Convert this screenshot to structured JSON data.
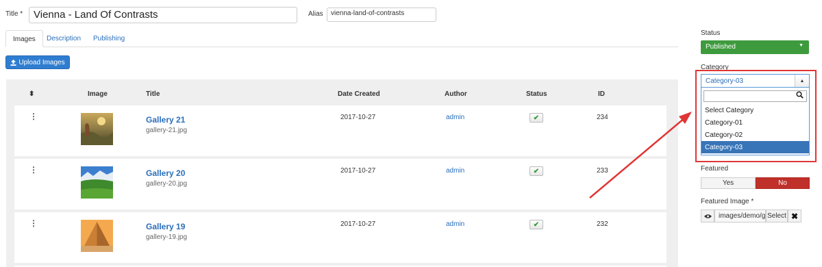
{
  "form": {
    "title_label": "Title *",
    "title_value": "Vienna - Land Of Contrasts",
    "alias_label": "Alias",
    "alias_value": "vienna-land-of-contrasts"
  },
  "tabs": [
    {
      "label": "Images",
      "active": true
    },
    {
      "label": "Description",
      "active": false
    },
    {
      "label": "Publishing",
      "active": false
    }
  ],
  "upload_button": {
    "label": "Upload Images",
    "icon": "upload-icon"
  },
  "table": {
    "headers": {
      "sort": "⬍",
      "image": "Image",
      "title": "Title",
      "date": "Date Created",
      "author": "Author",
      "status": "Status",
      "id": "ID"
    },
    "rows": [
      {
        "title": "Gallery 21",
        "file": "gallery-21.jpg",
        "date": "2017-10-27",
        "author": "admin",
        "status": "published",
        "id": "234",
        "thumb": "sunset-landscape"
      },
      {
        "title": "Gallery 20",
        "file": "gallery-20.jpg",
        "date": "2017-10-27",
        "author": "admin",
        "status": "published",
        "id": "233",
        "thumb": "green-valley"
      },
      {
        "title": "Gallery 19",
        "file": "gallery-19.jpg",
        "date": "2017-10-27",
        "author": "admin",
        "status": "published",
        "id": "232",
        "thumb": "pyramid"
      }
    ]
  },
  "sidebar": {
    "status_label": "Status",
    "status_value": "Published",
    "status_color": "#3d9b3d",
    "category_label": "Category",
    "category_value": "Category-03",
    "category_options": [
      "Select Category",
      "Category-01",
      "Category-02",
      "Category-03"
    ],
    "category_selected_index": 3,
    "featured_label": "Featured",
    "featured_yes": "Yes",
    "featured_no": "No",
    "featured_value": "No",
    "featured_no_color": "#c0302a",
    "featured_image_label": "Featured Image *",
    "featured_image_path": "images/demo/g",
    "featured_image_select": "Select"
  },
  "colors": {
    "accent": "#2a6ebb",
    "upload_button": "#2f7dd0",
    "highlight": "#e03535"
  }
}
